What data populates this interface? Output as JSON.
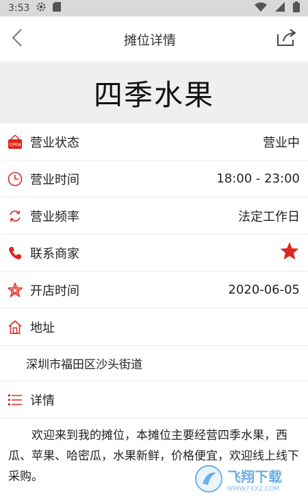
{
  "status_bar": {
    "time": "3:53"
  },
  "app_bar": {
    "title": "摊位详情"
  },
  "hero": {
    "name": "四季水果"
  },
  "rows": [
    {
      "label": "营业状态",
      "value": "营业中",
      "icon": "open-sign-icon"
    },
    {
      "label": "营业时间",
      "value": "18:00 - 23:00",
      "icon": "clock-icon"
    },
    {
      "label": "营业频率",
      "value": "法定工作日",
      "icon": "refresh-icon"
    },
    {
      "label": "联系商家",
      "value": "",
      "icon": "phone-icon"
    },
    {
      "label": "开店时间",
      "value": "2020-06-05",
      "icon": "star-outline-icon"
    },
    {
      "label": "地址",
      "value": "",
      "icon": "home-icon"
    }
  ],
  "address": "深圳市福田区沙头街道",
  "details": {
    "label": "详情",
    "text": "欢迎来到我的摊位，本摊位主要经营四季水果，西瓜、苹果、哈密瓜，水果新鲜，价格便宜，欢迎线上线下采购。"
  },
  "watermark": {
    "brand": "飞翔下载",
    "site": "WWW.FXXZ.COM"
  },
  "colors": {
    "accent": "#e0261c",
    "hero_bg": "#efefef",
    "divider": "#ececec"
  }
}
